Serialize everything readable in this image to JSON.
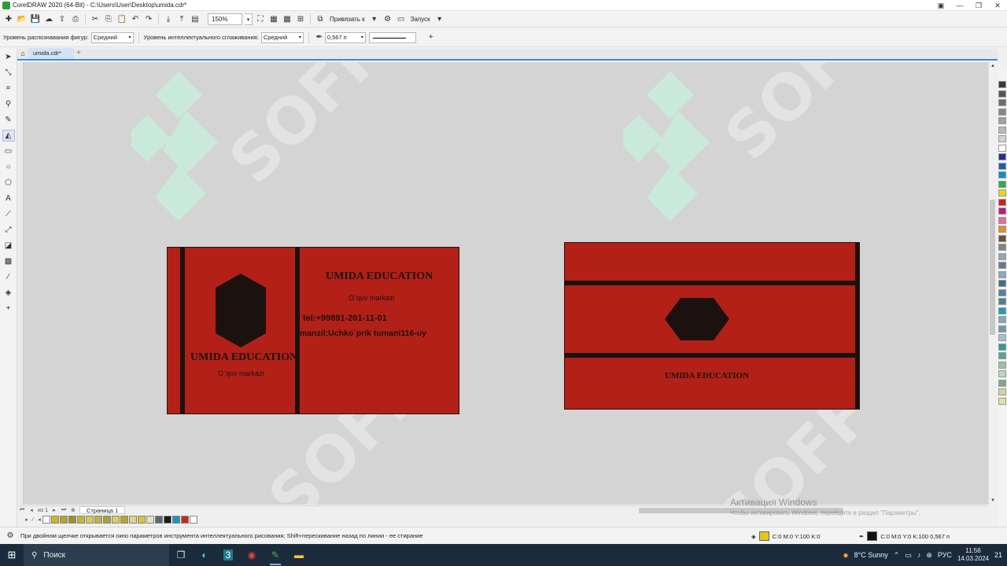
{
  "window": {
    "title": "CorelDRAW 2020 (64-Bit) - C:\\Users\\User\\Desktop\\umida.cdr*",
    "controls": [
      "▣",
      "—",
      "❐",
      "✕"
    ]
  },
  "toolbar": {
    "zoom_value": "150%",
    "snap_label": "Привязать к",
    "launch_label": "Запуск"
  },
  "property_bar": {
    "shape_recognition_label": "Уровень распознавания фигур:",
    "shape_recognition_value": "Средний",
    "smoothing_label": "Уровень интеллектуального сглаживания:",
    "smoothing_value": "Средний",
    "outline_width": "0,567 п"
  },
  "tabs": {
    "document": "umida.cdr*"
  },
  "canvas": {
    "watermark_text": "SOFF",
    "card_front": {
      "left_title": "UMIDA EDUCATION",
      "left_subtitle": "O`quv markazi",
      "right_title": "UMIDA EDUCATION",
      "right_subtitle": "O`quv markazi",
      "phone": "tel:+99891-201-11-01",
      "address": "manzil:Uchko`prik tumani116-uy"
    },
    "card_back": {
      "title": "UMIDA EDUCATION"
    },
    "fill_color": "#b32017",
    "dark_color": "#1b1210"
  },
  "page_nav": {
    "page_tab": "Страница 1",
    "page_count": "из 1"
  },
  "activation": {
    "title": "Активация Windows",
    "subtitle": "Чтобы активировать Windows, перейдите в раздел \"Параметры\"."
  },
  "statusbar": {
    "hint": "При двойном щелчке открывается окно параметров инструмента интеллектуального рисования; Shift+перескивание назад по линии - ее стирание",
    "fill_info": "C:0 M:0 Y:100 K:0",
    "outline_info": "C:0 M:0 Y:0 K:100  0,567 п",
    "fill_chip_color": "#e7c61b",
    "outline_chip_color": "#111111"
  },
  "taskbar": {
    "search_label": "Поиск",
    "weather": "8°C  Sunny",
    "lang": "РУС",
    "time": "11:56",
    "date": "14.03.2024",
    "notif_count": "21"
  },
  "palette_colors": [
    "#3a3a3a",
    "#555555",
    "#6e6e6e",
    "#878787",
    "#a0a0a0",
    "#b9b9b9",
    "#d2d2d2",
    "#ffffff",
    "#2b2c8e",
    "#1d5fae",
    "#0c8fc9",
    "#2eae4b",
    "#e9d71e",
    "#d11f1f",
    "#b51f7a",
    "#e46c9f",
    "#e98a2d",
    "#6b5136",
    "#7b868f",
    "#9aa6b1",
    "#637a90",
    "#8fa8be",
    "#3b6f8e",
    "#587da0",
    "#4c7e92",
    "#1f9bb4",
    "#85a9b8",
    "#6c9cab",
    "#a7c0cb",
    "#2e9e9a",
    "#5aa48f",
    "#9fbfa6",
    "#b9d6c0",
    "#7fa58a",
    "#cfd6a4",
    "#e4e0a2"
  ],
  "doc_palette": [
    "#c9b82a",
    "#b3a62a",
    "#9d9127",
    "#c1b83a",
    "#d7cc4d",
    "#bfb248",
    "#a8a13d",
    "#d6ce62",
    "#b8a52d",
    "#dcd58a",
    "#d1c53e",
    "#e6e2bf",
    "#5e6670",
    "#1a1a1a",
    "#1596c3",
    "#c7281f",
    "#ffffff"
  ]
}
